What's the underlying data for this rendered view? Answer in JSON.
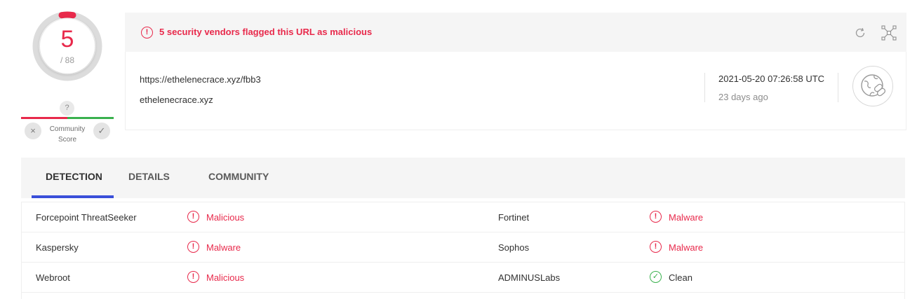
{
  "score": {
    "detections": "5",
    "total": "/ 88",
    "fraction": 0.057
  },
  "community": {
    "question": "?",
    "label": "Community Score",
    "downvote_glyph": "×",
    "upvote_glyph": "✓"
  },
  "alert": {
    "icon": "!",
    "text": "5 security vendors flagged this URL as malicious",
    "reload_icon": "refresh-icon",
    "graph_icon": "graph-icon"
  },
  "url": {
    "full": "https://ethelenecrace.xyz/fbb3",
    "domain": "ethelenecrace.xyz",
    "scan_date": "2021-05-20 07:26:58 UTC",
    "scan_ago": "23 days ago",
    "type_icon": "globe-link-icon"
  },
  "tabs": [
    {
      "label": "DETECTION",
      "active": true
    },
    {
      "label": "DETAILS",
      "active": false
    },
    {
      "label": "COMMUNITY",
      "active": false
    }
  ],
  "detections": [
    {
      "left": {
        "vendor": "Forcepoint ThreatSeeker",
        "result": "Malicious",
        "status": "bad",
        "icon": "!"
      },
      "right": {
        "vendor": "Fortinet",
        "result": "Malware",
        "status": "bad",
        "icon": "!"
      }
    },
    {
      "left": {
        "vendor": "Kaspersky",
        "result": "Malware",
        "status": "bad",
        "icon": "!"
      },
      "right": {
        "vendor": "Sophos",
        "result": "Malware",
        "status": "bad",
        "icon": "!"
      }
    },
    {
      "left": {
        "vendor": "Webroot",
        "result": "Malicious",
        "status": "bad",
        "icon": "!"
      },
      "right": {
        "vendor": "ADMINUSLabs",
        "result": "Clean",
        "status": "good",
        "icon": "✓"
      }
    }
  ],
  "colors": {
    "malicious": "#e8294b",
    "clean": "#3ab14e",
    "tab_accent": "#3a4fd9"
  }
}
